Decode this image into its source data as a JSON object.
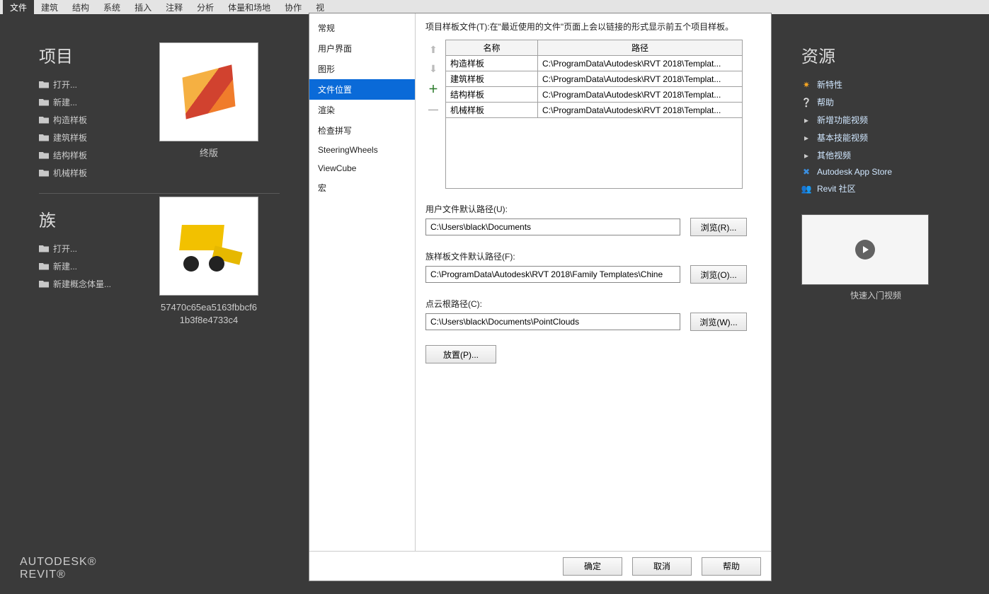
{
  "menubar": {
    "tabs": [
      "文件",
      "建筑",
      "结构",
      "系统",
      "插入",
      "注释",
      "分析",
      "体量和场地",
      "协作",
      "视"
    ],
    "active_index": 0
  },
  "left": {
    "projects_title": "项目",
    "project_links": [
      "打开...",
      "新建...",
      "构造样板",
      "建筑样板",
      "结构样板",
      "机械样板"
    ],
    "project_thumb_label": "终版",
    "families_title": "族",
    "family_links": [
      "打开...",
      "新建...",
      "新建概念体量..."
    ],
    "family_thumb_label": "57470c65ea5163fbbcf61b3f8e4733c4"
  },
  "right": {
    "title": "资源",
    "items": [
      "新特性",
      "帮助",
      "新增功能视频",
      "基本技能视频",
      "其他视频",
      "Autodesk App Store",
      "Revit 社区"
    ],
    "video_label": "快速入门视频"
  },
  "brand": {
    "line1": "AUTODESK®",
    "line2": "REVIT®"
  },
  "dialog": {
    "side_items": [
      "常规",
      "用户界面",
      "图形",
      "文件位置",
      "渲染",
      "检查拼写",
      "SteeringWheels",
      "ViewCube",
      "宏"
    ],
    "side_selected": 3,
    "desc": "项目样板文件(T):在\"最近使用的文件\"页面上会以链接的形式显示前五个项目样板。",
    "table": {
      "headers": [
        "名称",
        "路径"
      ],
      "rows": [
        {
          "name": "构造样板",
          "path": "C:\\ProgramData\\Autodesk\\RVT 2018\\Templat..."
        },
        {
          "name": "建筑样板",
          "path": "C:\\ProgramData\\Autodesk\\RVT 2018\\Templat..."
        },
        {
          "name": "结构样板",
          "path": "C:\\ProgramData\\Autodesk\\RVT 2018\\Templat..."
        },
        {
          "name": "机械样板",
          "path": "C:\\ProgramData\\Autodesk\\RVT 2018\\Templat..."
        }
      ]
    },
    "fields": {
      "user_label": "用户文件默认路径(U):",
      "user_value": "C:\\Users\\black\\Documents",
      "user_browse": "浏览(R)...",
      "fam_label": "族样板文件默认路径(F):",
      "fam_value": "C:\\ProgramData\\Autodesk\\RVT 2018\\Family Templates\\Chine",
      "fam_browse": "浏览(O)...",
      "pc_label": "点云根路径(C):",
      "pc_value": "C:\\Users\\black\\Documents\\PointClouds",
      "pc_browse": "浏览(W)...",
      "places": "放置(P)..."
    },
    "footer": {
      "ok": "确定",
      "cancel": "取消",
      "help": "帮助"
    }
  }
}
